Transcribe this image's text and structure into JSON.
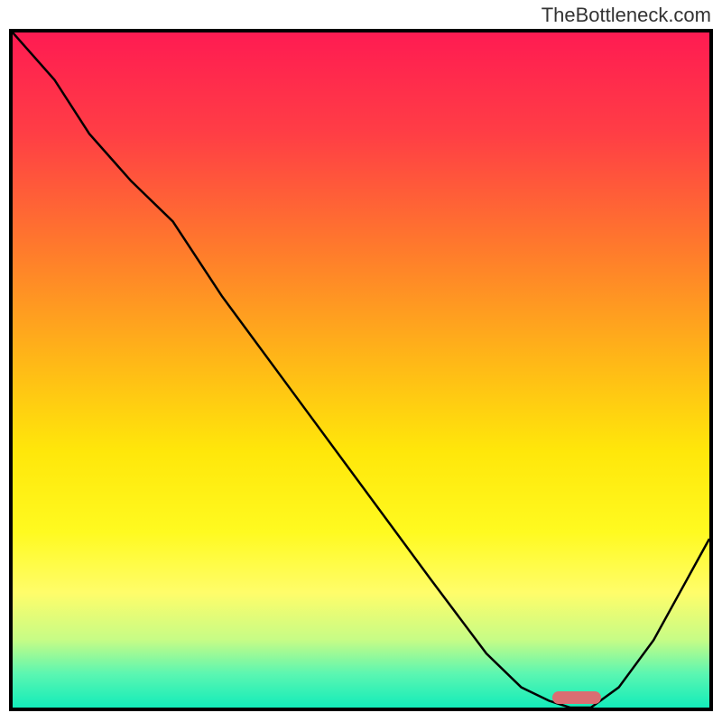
{
  "watermark": "TheBottleneck.com",
  "chart_data": {
    "type": "line",
    "title": "",
    "xlabel": "",
    "ylabel": "",
    "xlim": [
      0,
      100
    ],
    "ylim": [
      0,
      100
    ],
    "grid": false,
    "background_gradient": {
      "direction": "vertical",
      "stops": [
        {
          "pos": 0,
          "color": "#ff1b52"
        },
        {
          "pos": 15,
          "color": "#ff3e45"
        },
        {
          "pos": 32,
          "color": "#ff7a2c"
        },
        {
          "pos": 48,
          "color": "#ffb518"
        },
        {
          "pos": 62,
          "color": "#ffe70a"
        },
        {
          "pos": 74,
          "color": "#fffa20"
        },
        {
          "pos": 83,
          "color": "#fffd6a"
        },
        {
          "pos": 90,
          "color": "#c6fc86"
        },
        {
          "pos": 95,
          "color": "#5bf6b1"
        },
        {
          "pos": 100,
          "color": "#13ecba"
        }
      ]
    },
    "series": [
      {
        "name": "bottleneck-curve",
        "color": "#000000",
        "x": [
          0,
          6,
          11,
          17,
          23,
          30,
          40,
          50,
          60,
          68,
          73,
          77,
          80,
          83,
          87,
          92,
          100
        ],
        "values": [
          100,
          93,
          85,
          78,
          72,
          61,
          47,
          33,
          19,
          8,
          3,
          1,
          0,
          0,
          3,
          10,
          25
        ]
      }
    ],
    "marker": {
      "name": "optimal-zone",
      "color": "#da6e72",
      "x_center": 81,
      "width_pct": 7,
      "y_pos": 1.5
    }
  }
}
